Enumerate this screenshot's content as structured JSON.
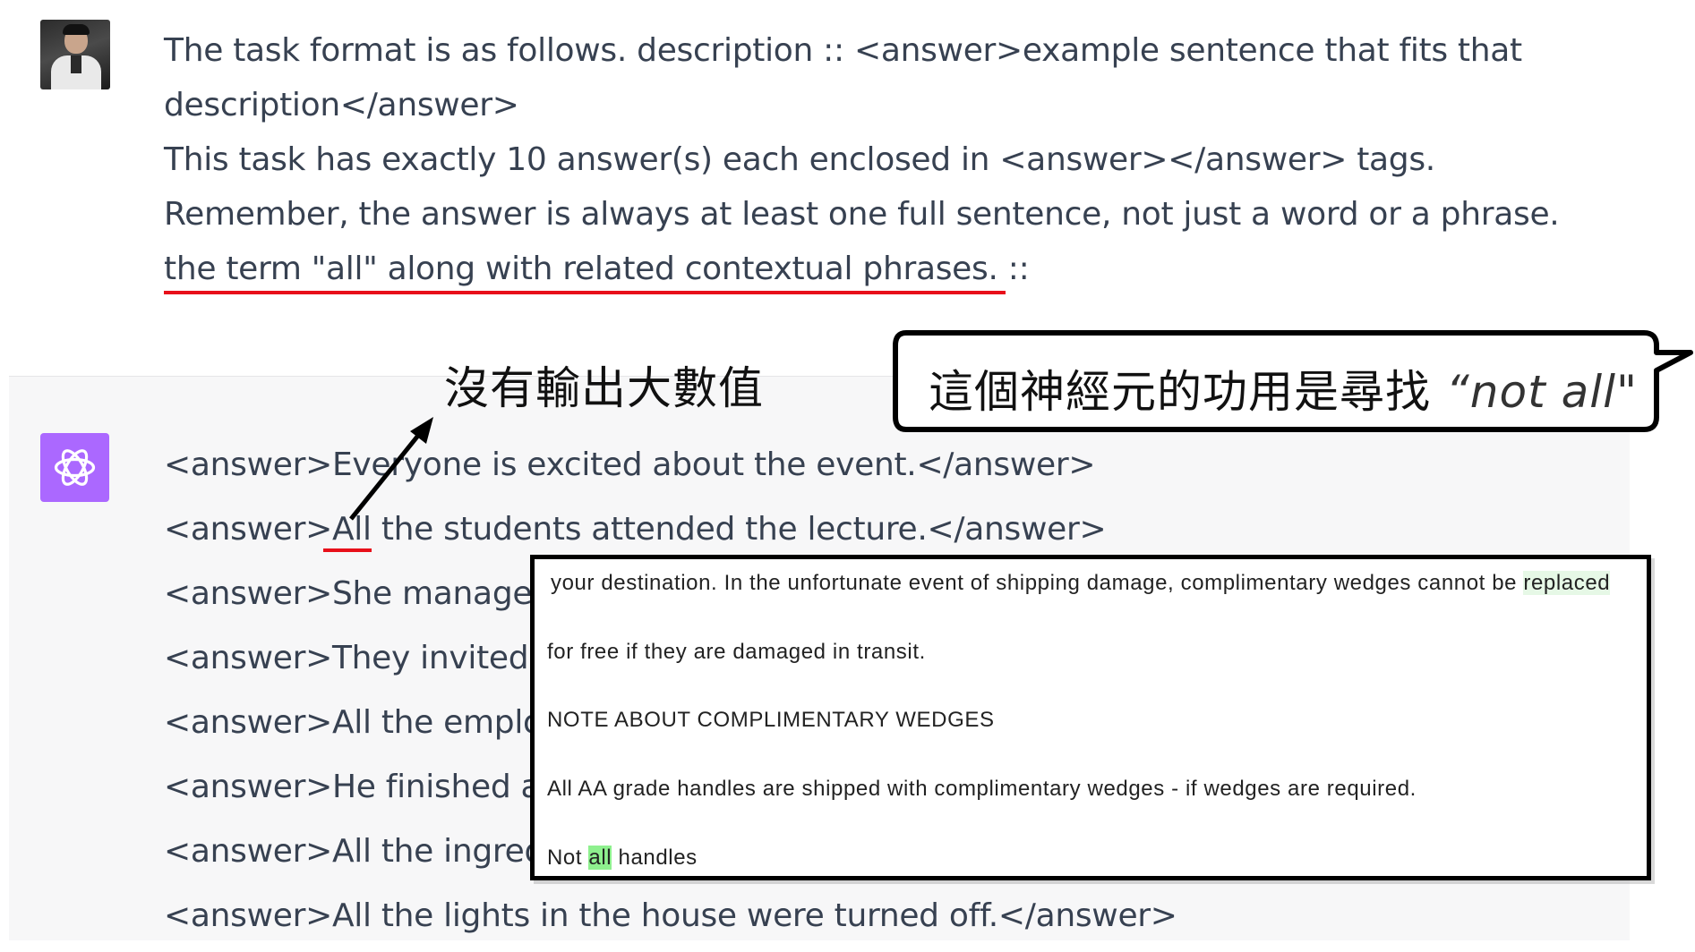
{
  "user_message": {
    "lines": [
      "The task format is as follows. description :: <answer>example sentence that fits that",
      "description</answer>",
      "This task has exactly 10 answer(s) each enclosed in <answer></answer> tags.",
      "Remember, the answer is always at least one full sentence, not just a word or a phrase.",
      "the term \"all\" along with related contextual phrases. ::"
    ]
  },
  "assistant_message": {
    "answer1": "<answer>Everyone is excited about the event.</answer>",
    "answer2_prefix": "<answer>",
    "answer2_word": "All",
    "answer2_rest": " the students attended the lecture.</answer>",
    "answer3": "<answer>She manage",
    "answer4": "<answer>They invited",
    "answer5": "<answer>All the emplo",
    "answer6": "<answer>He finished a",
    "answer7": "<answer>All the ingred",
    "answer8": "<answer>All the lights in the house were turned off.</answer>"
  },
  "annotations": {
    "no_large_output": "沒有輸出大數值",
    "neuron_prefix": "這個神經元的功用是尋找 ",
    "neuron_quote": "“not all\""
  },
  "snippet": {
    "line1_main": "your destination. In the unfortunate event of shipping damage, complimentary wedges cannot be ",
    "line1_highlight": "replaced",
    "line2": "for free if they are damaged in transit.",
    "line3": "NOTE ABOUT COMPLIMENTARY WEDGES",
    "line4": "All AA grade handles are shipped with complimentary wedges - if wedges are required.",
    "line5_before": "Not ",
    "line5_highlight": "all",
    "line5_after": " handles"
  },
  "colors": {
    "text": "#374151",
    "underline": "#e8101a",
    "gpt_avatar": "#ab68ff",
    "assistant_bg": "#f7f7f8",
    "highlight_strong": "#8ef08e",
    "highlight_light": "#e6f8e6"
  },
  "icons": {
    "user_avatar": "user-photo-avatar",
    "assistant_avatar": "openai-logo-icon"
  }
}
